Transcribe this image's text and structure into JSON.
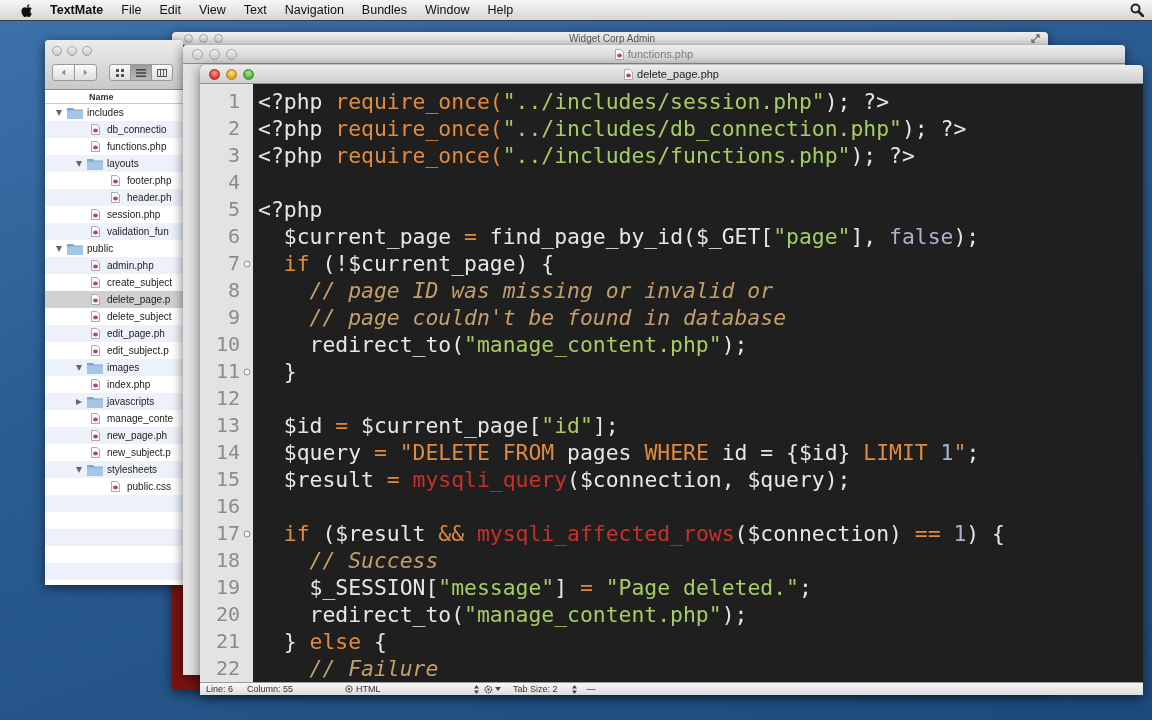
{
  "menu_bar": {
    "app_name": "TextMate",
    "menus": [
      "File",
      "Edit",
      "View",
      "Text",
      "Navigation",
      "Bundles",
      "Window",
      "Help"
    ]
  },
  "browser_window": {
    "title": "Widget Corp Admin",
    "active": false
  },
  "finder_window": {
    "active": false,
    "view_modes": [
      {
        "kind": "icons",
        "selected": false
      },
      {
        "kind": "list",
        "selected": true
      },
      {
        "kind": "columns",
        "selected": false
      }
    ],
    "column_header": "Name",
    "items": [
      {
        "kind": "folder",
        "name": "includes",
        "expanded": true,
        "selected": false,
        "children": [
          {
            "kind": "file",
            "name": "db_connectio",
            "selected": false
          },
          {
            "kind": "file",
            "name": "functions.php",
            "selected": false
          },
          {
            "kind": "folder",
            "name": "layouts",
            "expanded": true,
            "selected": false,
            "children": [
              {
                "kind": "file",
                "name": "footer.php",
                "selected": false
              },
              {
                "kind": "file",
                "name": "header.ph",
                "selected": false
              }
            ]
          },
          {
            "kind": "file",
            "name": "session.php",
            "selected": false
          },
          {
            "kind": "file",
            "name": "validation_fun",
            "selected": false
          }
        ]
      },
      {
        "kind": "folder",
        "name": "public",
        "expanded": true,
        "selected": false,
        "children": [
          {
            "kind": "file",
            "name": "admin.php",
            "selected": false
          },
          {
            "kind": "file",
            "name": "create_subject",
            "selected": false
          },
          {
            "kind": "file",
            "name": "delete_page.p",
            "selected": true
          },
          {
            "kind": "file",
            "name": "delete_subject",
            "selected": false
          },
          {
            "kind": "file",
            "name": "edit_page.ph",
            "selected": false
          },
          {
            "kind": "file",
            "name": "edit_subject.p",
            "selected": false
          },
          {
            "kind": "folder",
            "name": "images",
            "expanded": true,
            "selected": false
          },
          {
            "kind": "file",
            "name": "index.php",
            "selected": false
          },
          {
            "kind": "folder",
            "name": "javascripts",
            "expanded": false,
            "selected": false
          },
          {
            "kind": "file",
            "name": "manage_conte",
            "selected": false
          },
          {
            "kind": "file",
            "name": "new_page.ph",
            "selected": false
          },
          {
            "kind": "file",
            "name": "new_subject.p",
            "selected": false
          },
          {
            "kind": "folder",
            "name": "stylesheets",
            "expanded": true,
            "selected": false,
            "children": [
              {
                "kind": "file",
                "name": "public.css",
                "selected": false
              }
            ]
          }
        ]
      }
    ]
  },
  "functions_window": {
    "title": "functions.php",
    "active": false
  },
  "editor_window": {
    "title": "delete_page.php",
    "active": true,
    "lines": [
      {
        "number": "1",
        "fold": false,
        "tokens": [
          {
            "kind": "plain",
            "text": "<?php "
          },
          {
            "kind": "keyword",
            "text": "require_once("
          },
          {
            "kind": "string",
            "text": "\"../includes/session.php\""
          },
          {
            "kind": "plain",
            "text": "); ?>"
          }
        ]
      },
      {
        "number": "2",
        "fold": false,
        "tokens": [
          {
            "kind": "plain",
            "text": "<?php "
          },
          {
            "kind": "keyword",
            "text": "require_once("
          },
          {
            "kind": "string",
            "text": "\"../includes/db_connection.php\""
          },
          {
            "kind": "plain",
            "text": "); ?>"
          }
        ]
      },
      {
        "number": "3",
        "fold": false,
        "tokens": [
          {
            "kind": "plain",
            "text": "<?php "
          },
          {
            "kind": "keyword",
            "text": "require_once("
          },
          {
            "kind": "string",
            "text": "\"../includes/functions.php\""
          },
          {
            "kind": "plain",
            "text": "); ?>"
          }
        ]
      },
      {
        "number": "4",
        "fold": false
      },
      {
        "number": "5",
        "fold": false,
        "tokens": [
          {
            "kind": "plain",
            "text": "<?php"
          }
        ]
      },
      {
        "number": "6",
        "fold": false,
        "tokens": [
          {
            "kind": "plain",
            "text": "  $current_page "
          },
          {
            "kind": "operator",
            "text": "="
          },
          {
            "kind": "plain",
            "text": " find_page_by_id($_GET["
          },
          {
            "kind": "string",
            "text": "\"page\""
          },
          {
            "kind": "plain",
            "text": "], "
          },
          {
            "kind": "constant",
            "text": "false"
          },
          {
            "kind": "plain",
            "text": ");"
          }
        ]
      },
      {
        "number": "7",
        "fold": true,
        "tokens": [
          {
            "kind": "keyword",
            "text": "  if"
          },
          {
            "kind": "plain",
            "text": " (!$current_page) {"
          }
        ]
      },
      {
        "number": "8",
        "fold": false,
        "tokens": [
          {
            "kind": "comment",
            "text": "    // page ID was missing or invalid or"
          }
        ]
      },
      {
        "number": "9",
        "fold": false,
        "tokens": [
          {
            "kind": "comment",
            "text": "    // page couldn't be found in database"
          }
        ]
      },
      {
        "number": "10",
        "fold": false,
        "tokens": [
          {
            "kind": "plain",
            "text": "    redirect_to("
          },
          {
            "kind": "string",
            "text": "\"manage_content.php\""
          },
          {
            "kind": "plain",
            "text": ");"
          }
        ]
      },
      {
        "number": "11",
        "fold": true,
        "tokens": [
          {
            "kind": "plain",
            "text": "  }"
          }
        ]
      },
      {
        "number": "12",
        "fold": false
      },
      {
        "number": "13",
        "fold": false,
        "tokens": [
          {
            "kind": "plain",
            "text": "  $id "
          },
          {
            "kind": "operator",
            "text": "="
          },
          {
            "kind": "plain",
            "text": " $current_page["
          },
          {
            "kind": "string",
            "text": "\"id\""
          },
          {
            "kind": "plain",
            "text": "];"
          }
        ]
      },
      {
        "number": "14",
        "fold": false,
        "tokens": [
          {
            "kind": "plain",
            "text": "  $query "
          },
          {
            "kind": "operator",
            "text": "="
          },
          {
            "kind": "keyword",
            "text": " \"DELETE FROM"
          },
          {
            "kind": "plain",
            "text": " pages "
          },
          {
            "kind": "keyword",
            "text": "WHERE"
          },
          {
            "kind": "plain",
            "text": " id = {$id} "
          },
          {
            "kind": "keyword",
            "text": "LIMIT "
          },
          {
            "kind": "constant",
            "text": "1"
          },
          {
            "kind": "keyword",
            "text": "\""
          },
          {
            "kind": "plain",
            "text": ";"
          }
        ]
      },
      {
        "number": "15",
        "fold": false,
        "tokens": [
          {
            "kind": "plain",
            "text": "  $result "
          },
          {
            "kind": "operator",
            "text": "="
          },
          {
            "kind": "builtin",
            "text": " mysqli_query"
          },
          {
            "kind": "plain",
            "text": "($connection, $query);"
          }
        ]
      },
      {
        "number": "16",
        "fold": false
      },
      {
        "number": "17",
        "fold": true,
        "tokens": [
          {
            "kind": "keyword",
            "text": "  if"
          },
          {
            "kind": "plain",
            "text": " ($result "
          },
          {
            "kind": "operator",
            "text": "&&"
          },
          {
            "kind": "builtin",
            "text": " mysqli_affected_rows"
          },
          {
            "kind": "plain",
            "text": "($connection) "
          },
          {
            "kind": "operator",
            "text": "=="
          },
          {
            "kind": "constant",
            "text": " 1"
          },
          {
            "kind": "plain",
            "text": ") {"
          }
        ]
      },
      {
        "number": "18",
        "fold": false,
        "tokens": [
          {
            "kind": "comment",
            "text": "    // Success"
          }
        ]
      },
      {
        "number": "19",
        "fold": false,
        "tokens": [
          {
            "kind": "plain",
            "text": "    $_SESSION["
          },
          {
            "kind": "string",
            "text": "\"message\""
          },
          {
            "kind": "plain",
            "text": "] "
          },
          {
            "kind": "operator",
            "text": "="
          },
          {
            "kind": "string",
            "text": " \"Page deleted.\""
          },
          {
            "kind": "plain",
            "text": ";"
          }
        ]
      },
      {
        "number": "20",
        "fold": false,
        "tokens": [
          {
            "kind": "plain",
            "text": "    redirect_to("
          },
          {
            "kind": "string",
            "text": "\"manage_content.php\""
          },
          {
            "kind": "plain",
            "text": ");"
          }
        ]
      },
      {
        "number": "21",
        "fold": false,
        "tokens": [
          {
            "kind": "plain",
            "text": "  } "
          },
          {
            "kind": "keyword",
            "text": "else"
          },
          {
            "kind": "plain",
            "text": " {"
          }
        ]
      },
      {
        "number": "22",
        "fold": false,
        "tokens": [
          {
            "kind": "comment",
            "text": "    // Failure"
          }
        ]
      }
    ],
    "status_bar": {
      "line": "Line: 6",
      "column": "Column: 55",
      "language": "HTML",
      "tab_size": "Tab Size: 2",
      "symbol": "—"
    }
  }
}
